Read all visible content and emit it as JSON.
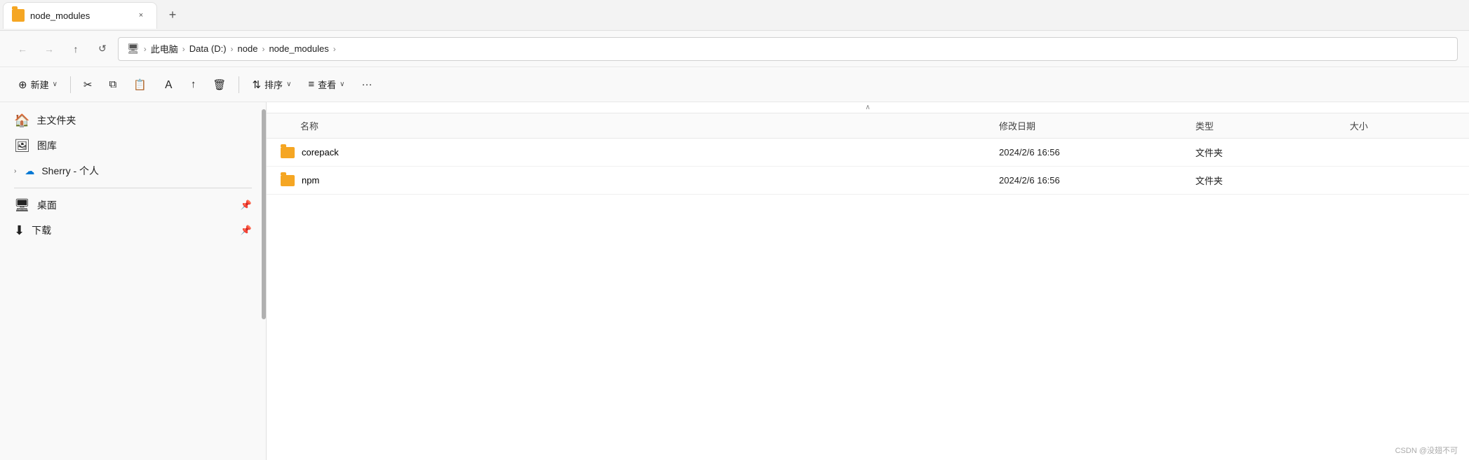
{
  "tab": {
    "title": "node_modules",
    "close_label": "×",
    "new_label": "+"
  },
  "address_bar": {
    "computer_label": "此电脑",
    "parts": [
      "此电脑",
      "Data (D:)",
      "node",
      "node_modules"
    ],
    "separator": "›"
  },
  "nav": {
    "back_label": "←",
    "forward_label": "→",
    "up_label": "↑",
    "refresh_label": "↺"
  },
  "toolbar": {
    "new_label": "新建",
    "new_icon": "⊕",
    "cut_icon": "✂",
    "copy_icon": "⧉",
    "paste_icon": "📋",
    "rename_icon": "Ａ",
    "share_icon": "↑",
    "delete_icon": "🗑",
    "sort_label": "排序",
    "sort_icon": "⇅",
    "view_label": "查看",
    "view_icon": "≡",
    "more_icon": "···"
  },
  "sidebar": {
    "items": [
      {
        "label": "主文件夹",
        "icon": "🏠"
      },
      {
        "label": "图库",
        "icon": "🖼"
      },
      {
        "label": "Sherry - 个人",
        "icon": "☁",
        "expandable": true,
        "icon_color": "#0078d4"
      },
      {
        "label": "桌面",
        "icon": "🖥",
        "pinned": true
      },
      {
        "label": "下载",
        "icon": "⬇",
        "pinned": true
      }
    ]
  },
  "file_list": {
    "columns": {
      "name": "名称",
      "date": "修改日期",
      "type": "类型",
      "size": "大小"
    },
    "files": [
      {
        "name": "corepack",
        "date": "2024/2/6 16:56",
        "type": "文件夹",
        "size": ""
      },
      {
        "name": "npm",
        "date": "2024/2/6 16:56",
        "type": "文件夹",
        "size": ""
      }
    ]
  },
  "watermark": "CSDN @没翅不可"
}
